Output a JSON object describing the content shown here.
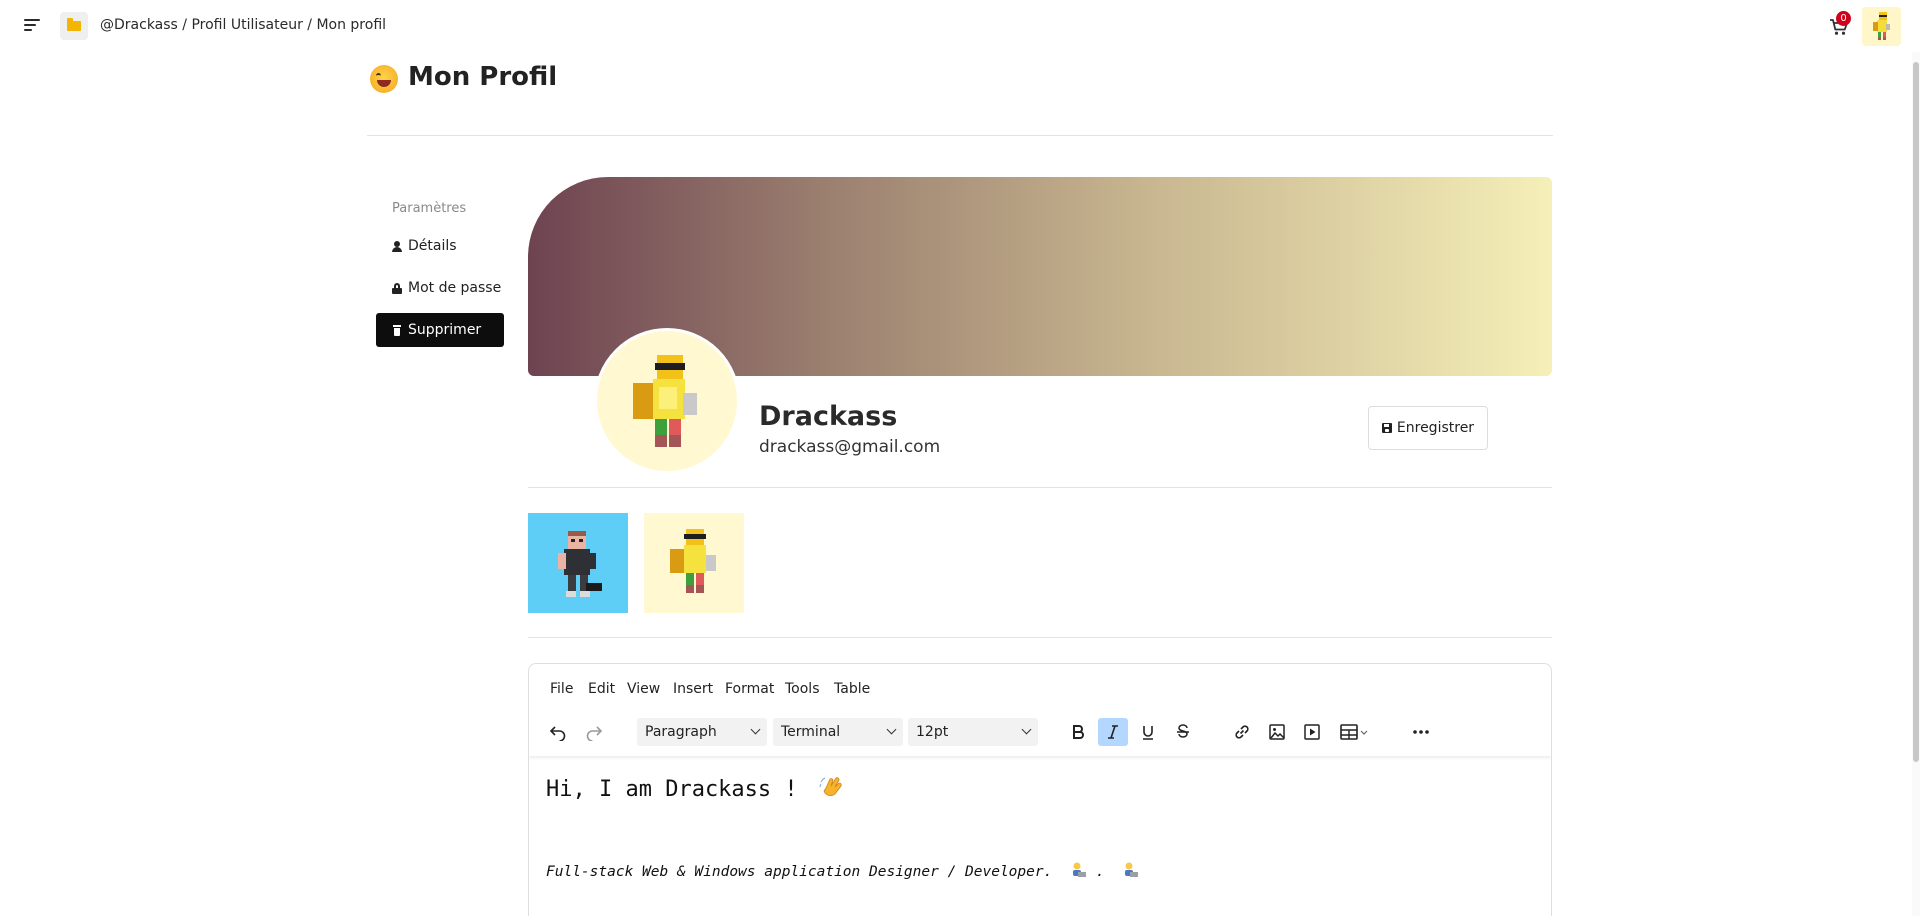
{
  "topbar": {
    "breadcrumb": "@Drackass / Profil Utilisateur / Mon profil",
    "cart_count": "0"
  },
  "page": {
    "title": "Mon Profil"
  },
  "sidebar": {
    "heading": "Paramètres",
    "items": [
      {
        "label": "Détails",
        "icon": "user-icon"
      },
      {
        "label": "Mot de passe",
        "icon": "lock-icon"
      },
      {
        "label": "Supprimer",
        "icon": "trash-icon",
        "active": true
      }
    ]
  },
  "profile": {
    "name": "Drackass",
    "email": "drackass@gmail.com",
    "save_label": "Enregistrer",
    "banner_colors": [
      "#6e4351",
      "#f5efb8"
    ],
    "thumbnail_colors": [
      "#5fcef7",
      "#fff8d0"
    ]
  },
  "editor": {
    "menu": [
      "File",
      "Edit",
      "View",
      "Insert",
      "Format",
      "Tools",
      "Table"
    ],
    "block_format": "Paragraph",
    "font_family": "Terminal",
    "font_size": "12pt",
    "active_format": "italic",
    "content": {
      "line1": "Hi, I am Drackass !",
      "line2": "Full-stack Web & Windows application Designer / Developer."
    }
  },
  "colors": {
    "accent_dark": "#0d0d0d",
    "badge_red": "#d0021b",
    "active_toolbar": "#b4d7ff"
  }
}
